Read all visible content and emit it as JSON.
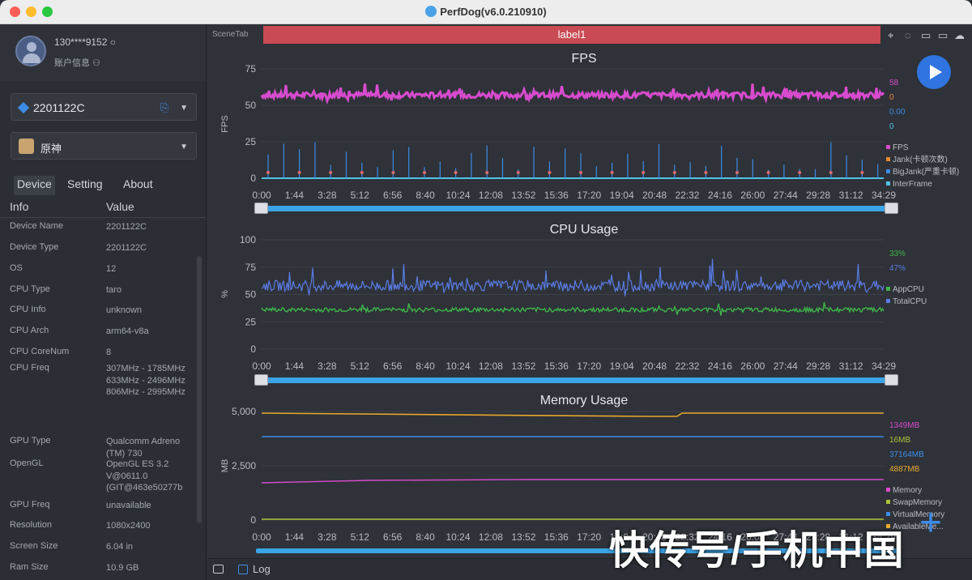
{
  "app": {
    "title": "PerfDog(v6.0.210910)"
  },
  "user": {
    "name": "130****9152 ○",
    "sub": "账户信息 ⚇"
  },
  "device": {
    "label": "2201122C",
    "link_icon": "⎘"
  },
  "app_select": {
    "label": "原神"
  },
  "tabs": {
    "device": "Device",
    "setting": "Setting",
    "about": "About"
  },
  "info": {
    "header_info": "Info",
    "header_value": "Value",
    "rows": [
      {
        "key": "Device Name",
        "value": "2201122C"
      },
      {
        "key": "Device Type",
        "value": "2201122C"
      },
      {
        "key": "OS",
        "value": "12"
      },
      {
        "key": "CPU Type",
        "value": "taro"
      },
      {
        "key": "CPU Info",
        "value": "unknown"
      },
      {
        "key": "CPU Arch",
        "value": "arm64-v8a"
      },
      {
        "key": "CPU CoreNum",
        "value": "8"
      },
      {
        "key": "CPU Freq",
        "value": "307MHz - 1785MHz 633MHz - 2496MHz 806MHz - 2995MHz"
      },
      {
        "key": "GPU Type",
        "value": "Qualcomm Adreno (TM) 730"
      },
      {
        "key": "OpenGL",
        "value": "OpenGL ES 3.2 V@0611.0 (GIT@463e50277b"
      },
      {
        "key": "GPU Freq",
        "value": "unavailable"
      },
      {
        "key": "Resolution",
        "value": "1080x2400"
      },
      {
        "key": "Screen Size",
        "value": "6.04 in"
      },
      {
        "key": "Ram Size",
        "value": "10.9 GB"
      }
    ]
  },
  "scene_tab": "SceneTab",
  "label_bar": "label1",
  "time_ticks": [
    "0:00",
    "1:44",
    "3:28",
    "5:12",
    "6:56",
    "8:40",
    "10:24",
    "12:08",
    "13:52",
    "15:36",
    "17:20",
    "19:04",
    "20:48",
    "22:32",
    "24:16",
    "26:00",
    "27:44",
    "29:28",
    "31:12",
    "34:29"
  ],
  "charts": {
    "fps": {
      "title": "FPS",
      "ylabel": "FPS",
      "yticks": [
        "75",
        "50",
        "25",
        "0"
      ],
      "readouts": [
        {
          "text": "58",
          "color": "#d84bcf"
        },
        {
          "text": "0",
          "color": "#e8872e"
        },
        {
          "text": "0.00",
          "color": "#3c8ce7"
        },
        {
          "text": "0",
          "color": "#4fc3e8"
        }
      ],
      "legend": [
        {
          "text": "FPS",
          "color": "#d84bcf"
        },
        {
          "text": "Jank(卡顿次数)",
          "color": "#e8872e"
        },
        {
          "text": "BigJank(严重卡顿)",
          "color": "#3c8ce7"
        },
        {
          "text": "InterFrame",
          "color": "#4fc3e8"
        }
      ]
    },
    "cpu": {
      "title": "CPU Usage",
      "ylabel": "%",
      "yticks": [
        "100",
        "75",
        "50",
        "25",
        "0"
      ],
      "readouts": [
        {
          "text": "33%",
          "color": "#3fb54a"
        },
        {
          "text": "47%",
          "color": "#5a7de6"
        }
      ],
      "legend": [
        {
          "text": "AppCPU",
          "color": "#3fb54a"
        },
        {
          "text": "TotalCPU",
          "color": "#5a7de6"
        }
      ]
    },
    "mem": {
      "title": "Memory Usage",
      "ylabel": "MB",
      "yticks": [
        "5,000",
        "2,500",
        "0"
      ],
      "readouts": [
        {
          "text": "1349MB",
          "color": "#d84bcf"
        },
        {
          "text": "16MB",
          "color": "#a8c43a"
        },
        {
          "text": "37164MB",
          "color": "#3c8ce7"
        },
        {
          "text": "4887MB",
          "color": "#e8a82e"
        }
      ],
      "legend": [
        {
          "text": "Memory",
          "color": "#d84bcf"
        },
        {
          "text": "SwapMemory",
          "color": "#a8c43a"
        },
        {
          "text": "VirtualMemory",
          "color": "#3c8ce7"
        },
        {
          "text": "AvailableMe...",
          "color": "#e8a82e"
        }
      ]
    }
  },
  "footer": {
    "log": "Log"
  },
  "watermark": "快传号/手机中国"
}
